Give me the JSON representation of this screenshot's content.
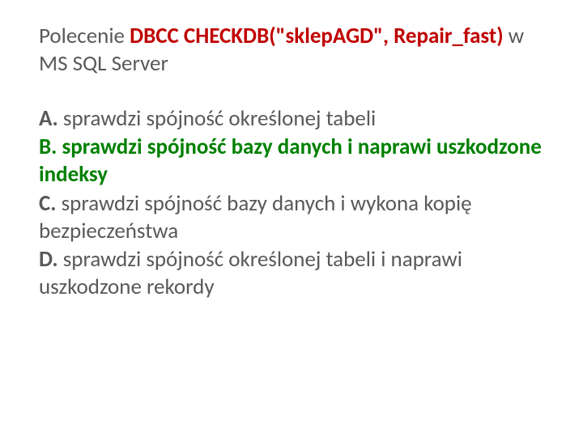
{
  "question": {
    "prefix": "Polecenie ",
    "command": "DBCC CHECKDB(\"sklepAGD\", Repair_fast)",
    "suffix": " w MS SQL Server"
  },
  "options": {
    "a": {
      "letter": "A.",
      "text": " sprawdzi spójność określonej tabeli"
    },
    "b": {
      "letter": "B.",
      "text": " sprawdzi spójność bazy danych i naprawi uszkodzone indeksy"
    },
    "c": {
      "letter": "C.",
      "text": " sprawdzi spójność bazy danych i wykona kopię bezpieczeństwa"
    },
    "d": {
      "letter": "D.",
      "text": " sprawdzi spójność określonej tabeli i naprawi uszkodzone rekordy"
    }
  }
}
